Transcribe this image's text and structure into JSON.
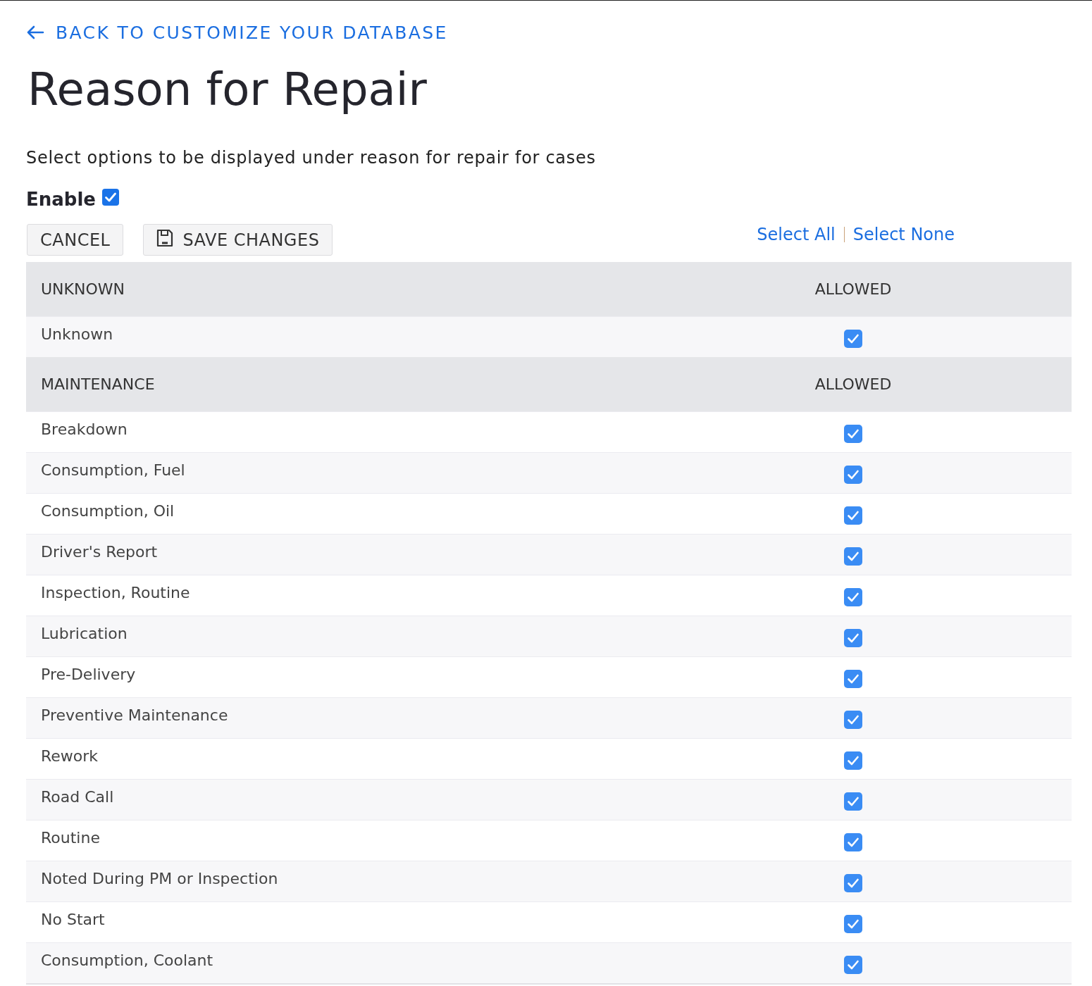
{
  "back_link": {
    "label": "BACK TO CUSTOMIZE YOUR DATABASE"
  },
  "title": "Reason for Repair",
  "description": "Select options to be displayed under reason for repair for cases",
  "enable": {
    "label": "Enable",
    "checked": true
  },
  "buttons": [
    {
      "label": "CANCEL",
      "kind": "plain"
    },
    {
      "label": "SAVE CHANGES",
      "kind": "save"
    }
  ],
  "selection_links": [
    "Select All",
    "Select None"
  ],
  "groups": [
    {
      "name": "UNKNOWN",
      "column_label": "ALLOWED",
      "rows": [
        {
          "label": "Unknown",
          "allowed": true
        }
      ]
    },
    {
      "name": "MAINTENANCE",
      "column_label": "ALLOWED",
      "rows": [
        {
          "label": "Breakdown",
          "allowed": true
        },
        {
          "label": "Consumption, Fuel",
          "allowed": true
        },
        {
          "label": "Consumption, Oil",
          "allowed": true
        },
        {
          "label": "Driver's Report",
          "allowed": true
        },
        {
          "label": "Inspection, Routine",
          "allowed": true
        },
        {
          "label": "Lubrication",
          "allowed": true
        },
        {
          "label": "Pre-Delivery",
          "allowed": true
        },
        {
          "label": "Preventive Maintenance",
          "allowed": true
        },
        {
          "label": "Rework",
          "allowed": true
        },
        {
          "label": "Road Call",
          "allowed": true
        },
        {
          "label": "Routine",
          "allowed": true
        },
        {
          "label": "Noted During PM or Inspection",
          "allowed": true
        },
        {
          "label": "No Start",
          "allowed": true
        },
        {
          "label": "Consumption, Coolant",
          "allowed": true
        }
      ]
    }
  ]
}
